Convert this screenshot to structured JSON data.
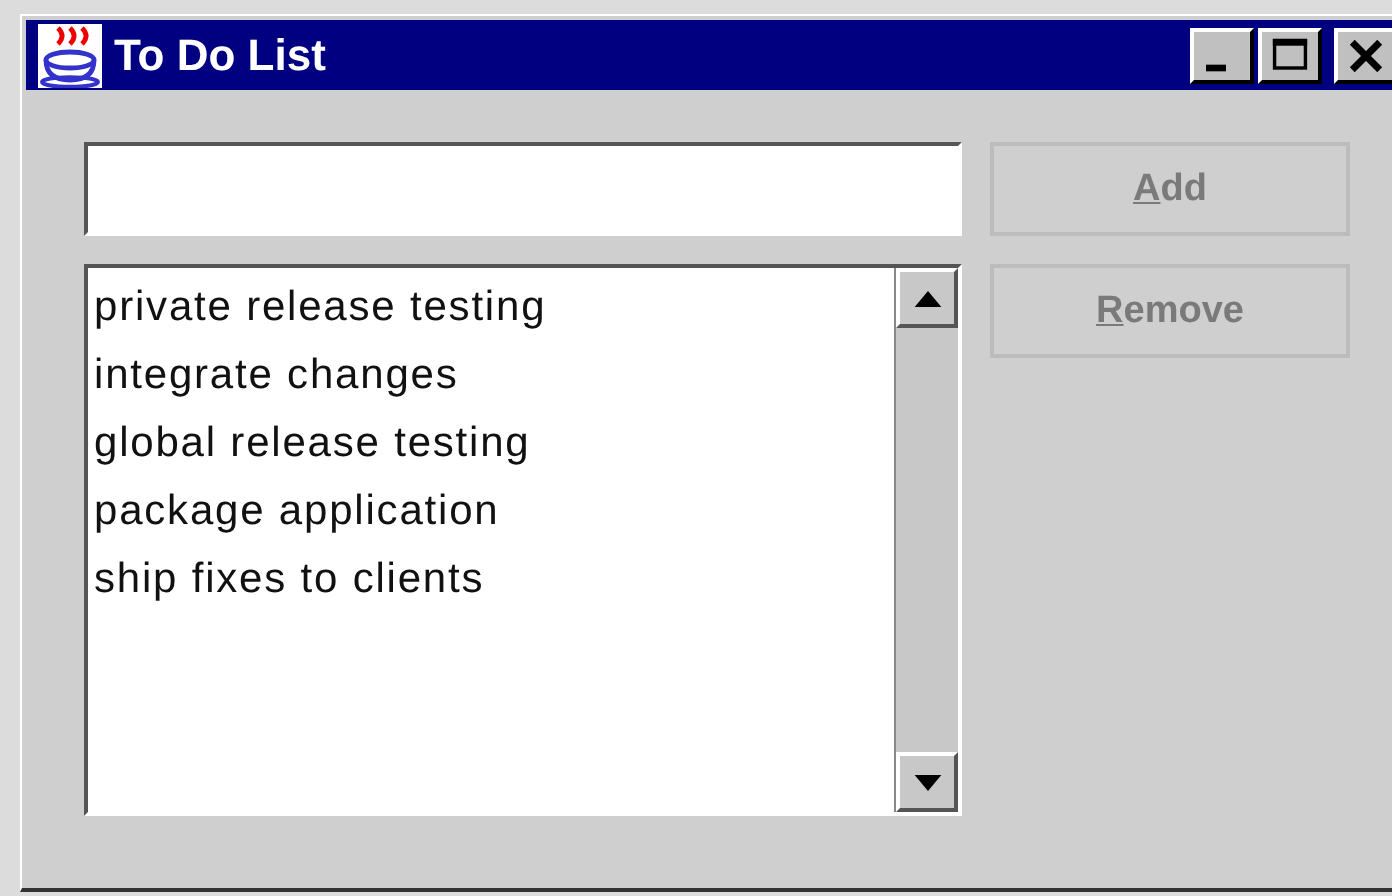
{
  "window": {
    "title": "To Do List"
  },
  "buttons": [
    {
      "mnemonic": "A",
      "label_rest": "dd",
      "disabled": true
    },
    {
      "mnemonic": "R",
      "label_rest": "emove",
      "disabled": true
    }
  ],
  "list": {
    "items": [
      {
        "label": "private release testing",
        "selected": false
      },
      {
        "label": "integrate changes",
        "selected": false
      },
      {
        "label": "global release testing",
        "selected": false
      },
      {
        "label": "package application",
        "selected": false
      },
      {
        "label": "ship fixes to clients",
        "selected": false
      }
    ]
  }
}
